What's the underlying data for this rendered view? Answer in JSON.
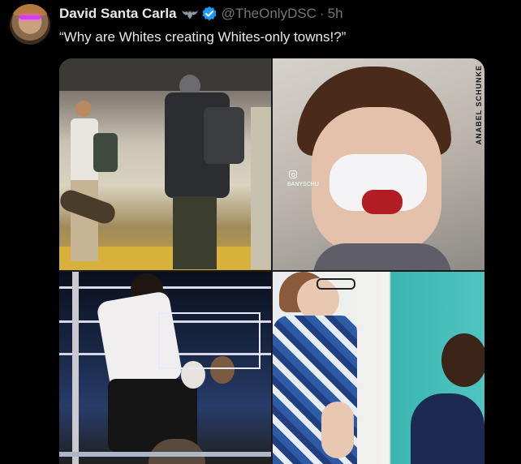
{
  "author": {
    "display_name": "David Santa Carla",
    "handle": "@TheOnlyDSC",
    "separator": "·",
    "timestamp": "5h",
    "badge_icons": [
      "bat-emoji-icon",
      "verified-badge-icon"
    ]
  },
  "tweet": {
    "text": "“Why are Whites creating Whites-only towns!?”"
  },
  "media": {
    "items": [
      {
        "name": "subway-platform-photo"
      },
      {
        "name": "injured-man-selfie-photo",
        "watermark": "ANABEL SCHUNKE",
        "tag": "BANYSCHU"
      },
      {
        "name": "wrestling-ring-photo"
      },
      {
        "name": "classroom-teacher-photo"
      }
    ]
  },
  "colors": {
    "background": "#000000",
    "primary_text": "#e7e9ea",
    "secondary_text": "#71767b",
    "verified_blue": "#1d9bf0"
  }
}
